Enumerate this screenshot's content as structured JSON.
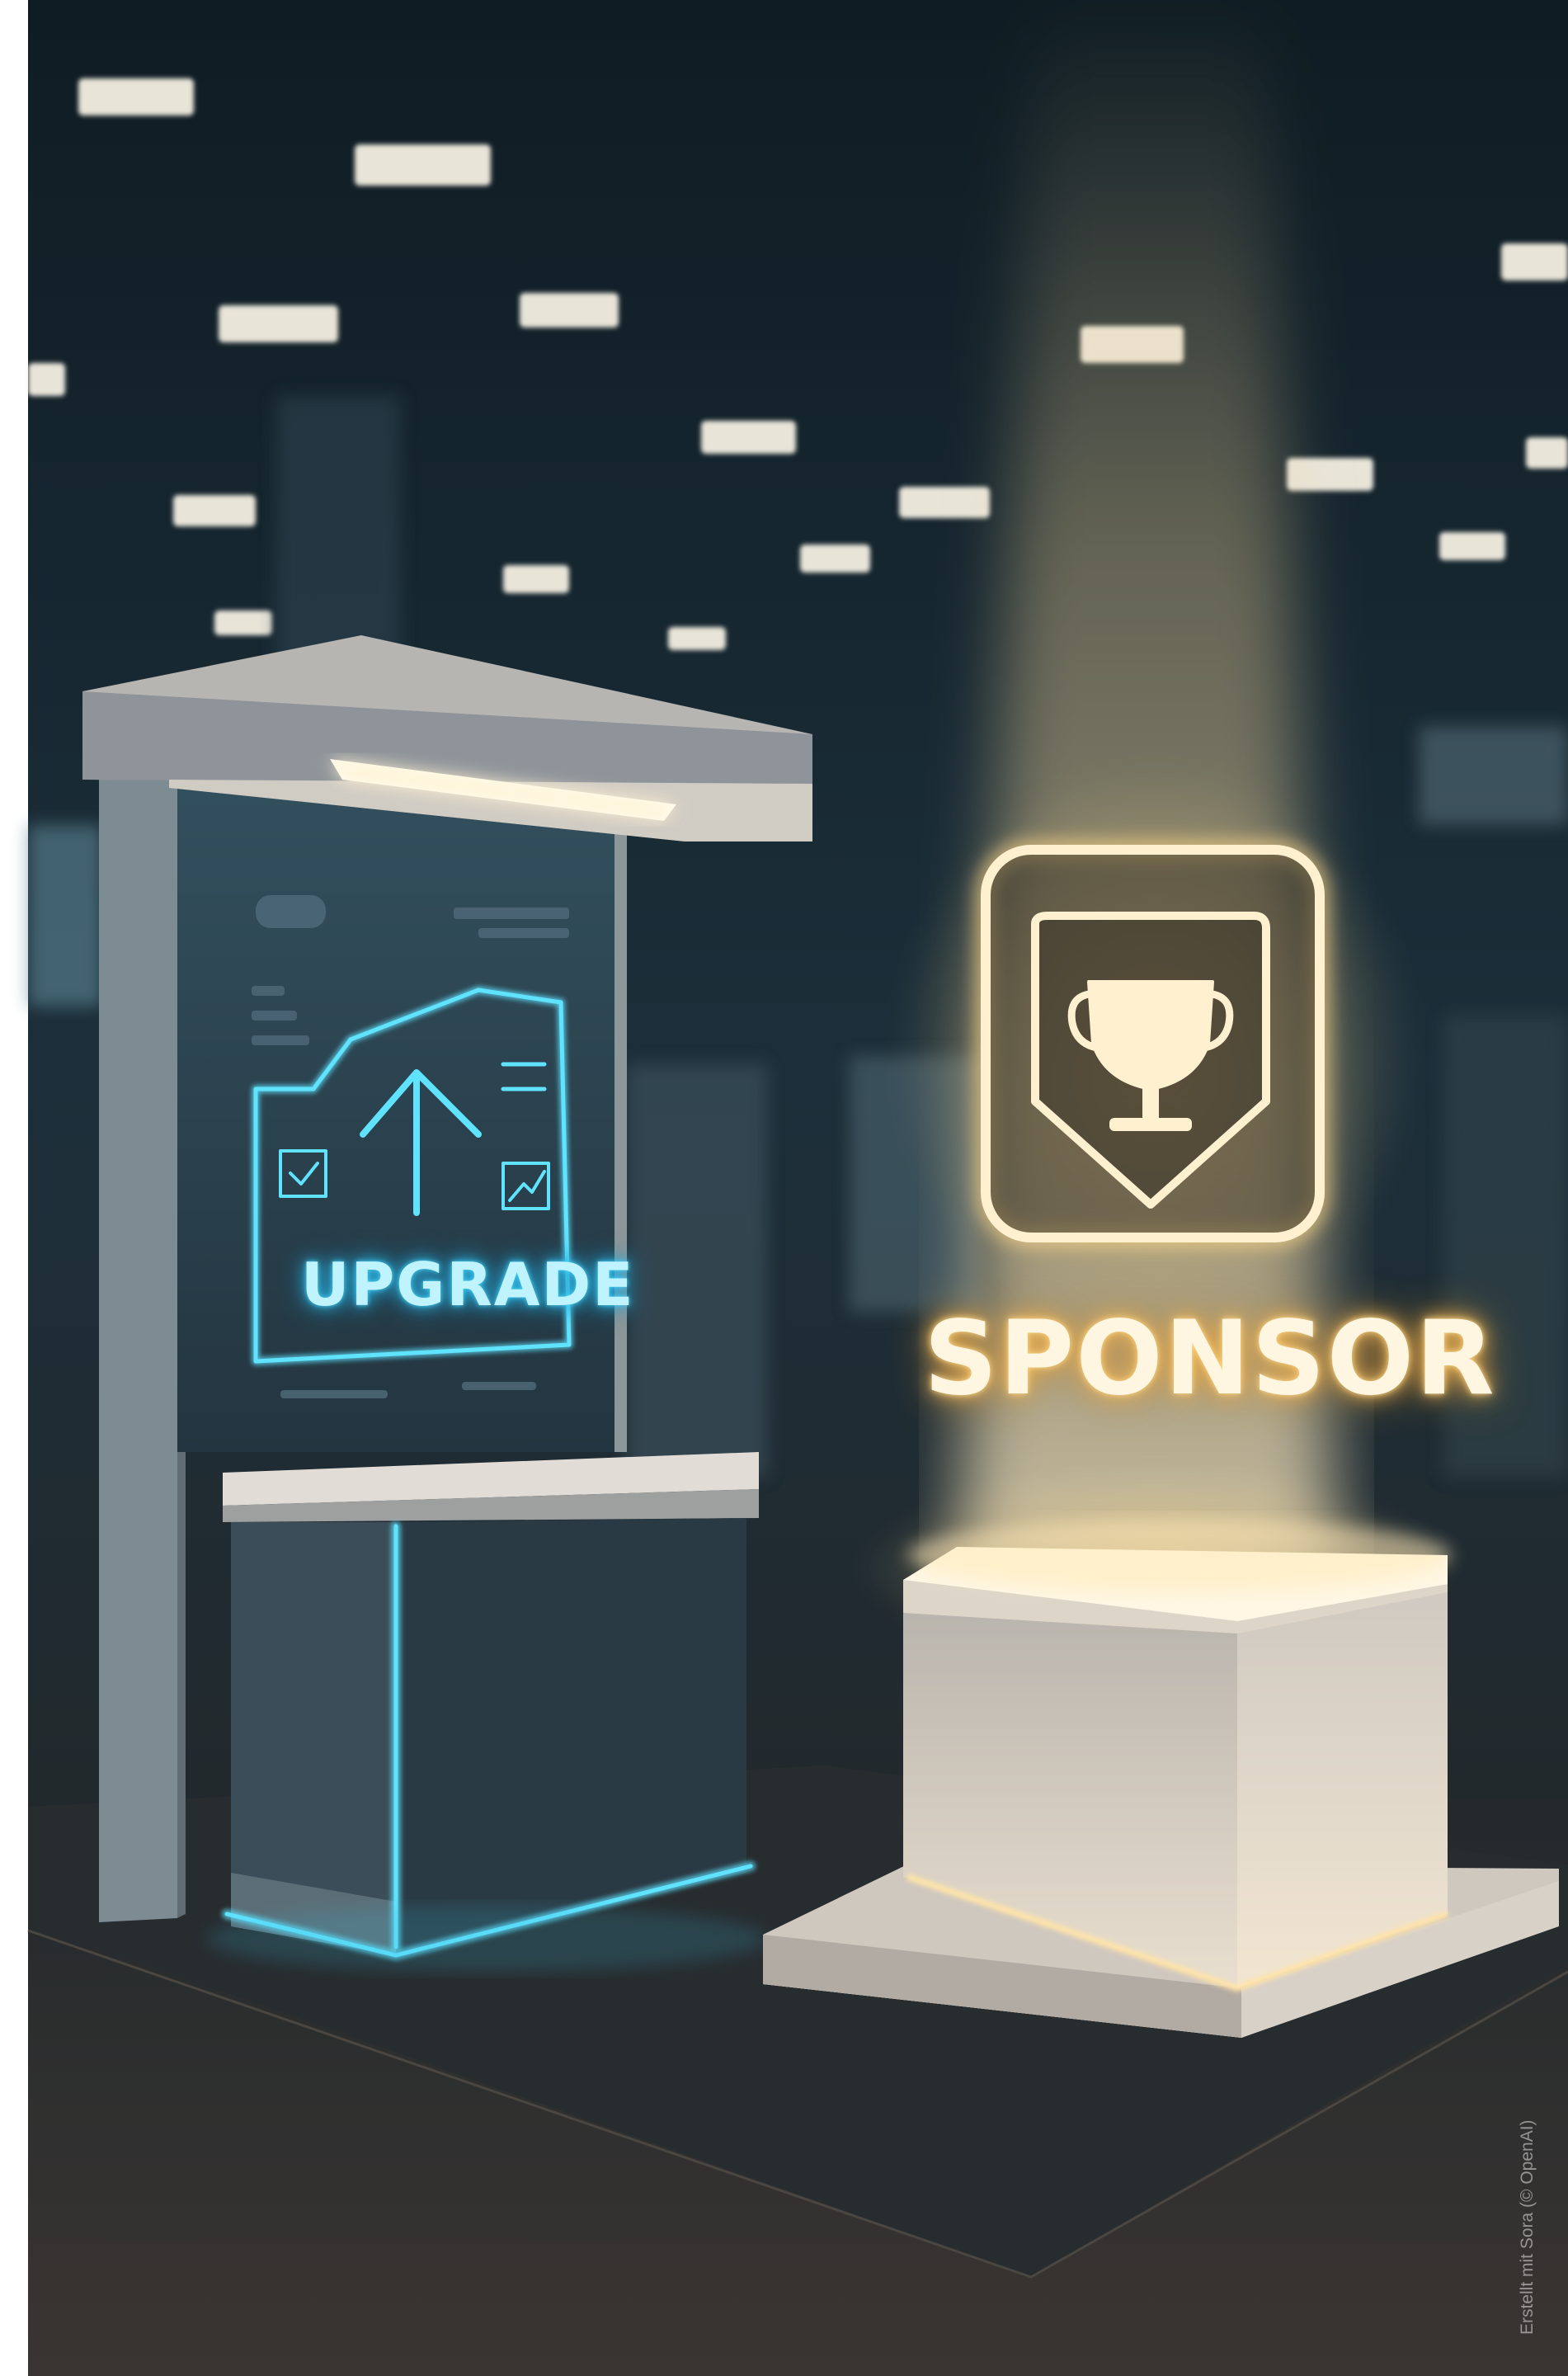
{
  "scene": {
    "upgrade_sign": "UPGRADE",
    "sponsor_sign": "SPONSOR",
    "credit": "Erstellt mit Sora (© OpenAI)"
  },
  "colors": {
    "upgrade_glow": "#49d6ff",
    "sponsor_glow": "#f3c46a",
    "booth_panel": "#2a3d48",
    "pedestal": "#d9d4cc",
    "floor": "#24282b",
    "backdrop": "#1b2a33"
  },
  "icons": {
    "upgrade_icon": "upload-arrow-folder-icon",
    "sponsor_icon": "trophy-badge-icon"
  }
}
